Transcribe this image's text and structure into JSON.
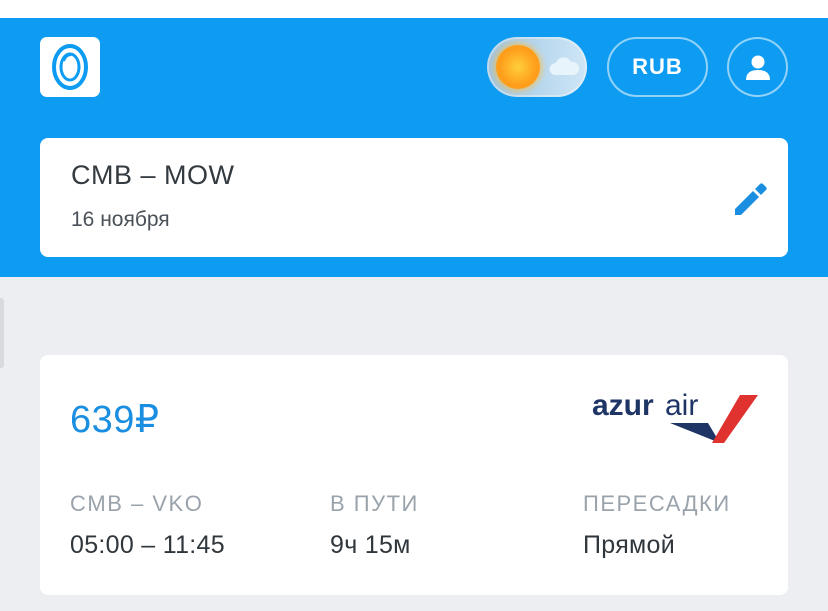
{
  "header": {
    "currency": "RUB",
    "theme_mode": "day",
    "brand_color": "#0d9cf1"
  },
  "search": {
    "route": "CMB – MOW",
    "date": "16 ноября"
  },
  "ticket": {
    "price": "639₽",
    "airline": {
      "name_part1": "azur",
      "name_part2": "air"
    },
    "segment_label": "CMB – VKO",
    "segment_time": "05:00 – 11:45",
    "duration_label": "В ПУТИ",
    "duration_value": "9ч 15м",
    "transfers_label": "ПЕРЕСАДКИ",
    "transfers_value": "Прямой"
  },
  "icons": {
    "logo": "porthole-logo-icon",
    "sun": "sun-icon",
    "cloud": "cloud-icon",
    "profile": "user-icon",
    "edit": "pencil-icon"
  }
}
